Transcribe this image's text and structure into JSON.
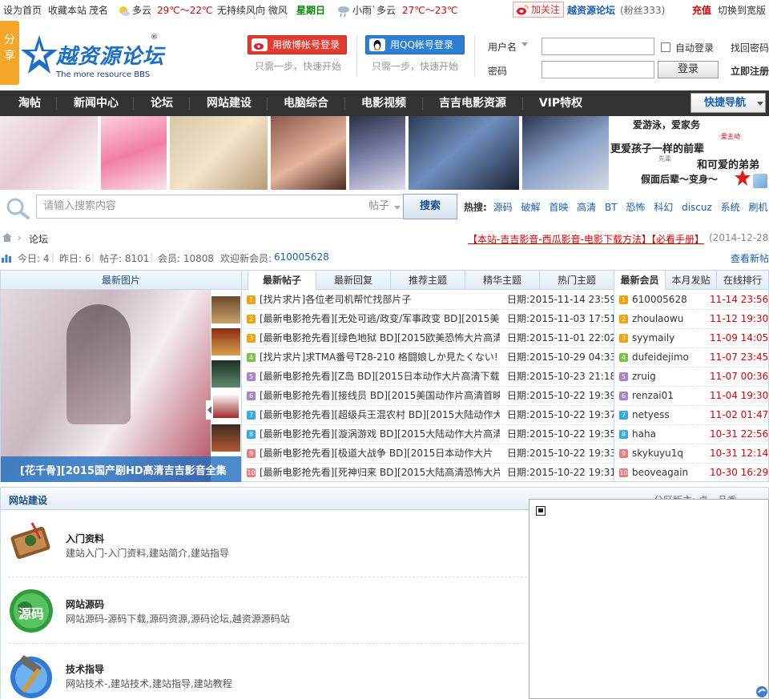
{
  "topbar": {
    "set_home": "设为首页",
    "bookmark": "收藏本站",
    "city": "茂名",
    "weather1": "多云",
    "temp1": "29℃～22℃",
    "wind": "无持续风向 微风",
    "weekday": "星期日",
    "weather2": "小雨`多云",
    "temp2": "27℃～23℃",
    "follow": "加关注",
    "weibo_name": "越资源论坛",
    "fans": "(粉丝333)",
    "recharge": "充值",
    "wide": "切换到宽版"
  },
  "header": {
    "share": "分享",
    "logo_title": "越资源论坛",
    "logo_sub": "The more resource BBS",
    "logo_reg": "®",
    "weibo_login": "用微博帐号登录",
    "qq_login": "用QQ帐号登录",
    "hint": "只需一步，快速开始",
    "username_label": "用户名",
    "password_label": "密码",
    "auto_login": "自动登录",
    "login": "登录",
    "find_password": "找回密码",
    "register": "立即注册"
  },
  "nav": {
    "items": [
      "淘帖",
      "新闻中心",
      "论坛",
      "网站建设",
      "电脑综合",
      "电影视频",
      "吉吉电影资源",
      "VIP特权"
    ],
    "quick_nav": "快捷导航"
  },
  "ad": {
    "line1": "爱游泳，爱家务",
    "line2": "更爱孩子一样的前辈",
    "line3": "和可爱的弟弟",
    "line4": "假面后辈～变身～",
    "tag1": "爱主动",
    "tag2": "先辈"
  },
  "search": {
    "placeholder": "请输入搜索内容",
    "type": "帖子",
    "button": "搜索",
    "hot_label": "热搜:",
    "hot_words": [
      "源码",
      "破解",
      "首映",
      "高清",
      "BT",
      "恐怖",
      "科幻",
      "discuz",
      "系统",
      "刷机"
    ]
  },
  "crumb": {
    "current": "论坛",
    "notice": "【本站-吉吉影音-西瓜影音-电影下载方法】【必看手册】",
    "notice_date": "(2014-12-28)"
  },
  "stats": {
    "today": "今日: 4",
    "yesterday": "昨日: 6",
    "posts": "帖子: 8101",
    "members": "会员: 10808",
    "welcome": "欢迎新会员: ",
    "new_member": "610005628",
    "view_new": "查看新帖"
  },
  "pics": {
    "tab": "最新图片",
    "caption": "[花千骨][2015国产剧HD高清吉吉影音全集"
  },
  "threads": {
    "tabs": [
      "最新帖子",
      "最新回复",
      "推荐主题",
      "精华主题",
      "热门主题"
    ],
    "items": [
      {
        "n": "1",
        "title": "[找片求片]各位老司机帮忙找部片子",
        "date": "日期:2015-11-14 23:59"
      },
      {
        "n": "2",
        "title": "[最新电影抢先看][无处可逃/政变/军事政变 BD][2015美国",
        "date": "日期:2015-11-03 17:51"
      },
      {
        "n": "3",
        "title": "[最新电影抢先看][绿色地狱 BD][2015欧美恐怖大片高清",
        "date": "日期:2015-11-01 22:02"
      },
      {
        "n": "4",
        "title": "[找片求片]求TMA番号T28-210 格闘娘しか見たくない! 4",
        "date": "日期:2015-10-29 04:33"
      },
      {
        "n": "5",
        "title": "[最新电影抢先看][Z岛 BD][2015日本动作大片高清下载]",
        "date": "日期:2015-10-23 21:18"
      },
      {
        "n": "6",
        "title": "[最新电影抢先看][接线员 BD][2015美国动作片高清首映",
        "date": "日期:2015-10-22 19:39"
      },
      {
        "n": "7",
        "title": "[最新电影抢先看][超级兵王混农村 BD][2015大陆动作大",
        "date": "日期:2015-10-22 19:37"
      },
      {
        "n": "8",
        "title": "[最新电影抢先看][漩涡游戏 BD][2015大陆动作大片高清",
        "date": "日期:2015-10-22 19:35"
      },
      {
        "n": "9",
        "title": "[最新电影抢先看][极道大战争 BD][2015日本动作大片",
        "date": "日期:2015-10-22 19:33"
      },
      {
        "n": "10",
        "title": "[最新电影抢先看][死神归来 BD][2015大陆高清恐怖大片",
        "date": "日期:2015-10-22 19:31"
      }
    ]
  },
  "members": {
    "tabs": [
      "最新会员",
      "本月发贴",
      "在线排行"
    ],
    "items": [
      {
        "n": "1",
        "name": "610005628",
        "date": "11-14 23:56"
      },
      {
        "n": "2",
        "name": "zhoulaowu",
        "date": "11-12 19:30"
      },
      {
        "n": "3",
        "name": "syymaily",
        "date": "11-09 14:05"
      },
      {
        "n": "4",
        "name": "dufeidejimo",
        "date": "11-07 23:45"
      },
      {
        "n": "5",
        "name": "zruig",
        "date": "11-07 00:36"
      },
      {
        "n": "6",
        "name": "renzai01",
        "date": "11-04 19:30"
      },
      {
        "n": "7",
        "name": "netyess",
        "date": "11-02 01:47"
      },
      {
        "n": "8",
        "name": "haha",
        "date": "10-31 22:56"
      },
      {
        "n": "9",
        "name": "skykuyu1q",
        "date": "10-31 12:14"
      },
      {
        "n": "10",
        "name": "beoveagain",
        "date": "10-30 16:29"
      }
    ]
  },
  "section": {
    "title": "网站建设",
    "moderator": "分区版主: 卓一品秀",
    "forums": [
      {
        "title": "入门资料",
        "desc": "建站入门-入门资料,建站简介,建站指导"
      },
      {
        "title": "网站源码",
        "desc": "网站源码-源码下载,源码资源,源码论坛,越资源源码站"
      },
      {
        "title": "技术指导",
        "desc": "网站技术-,建站技术,建站指导,建站教程"
      }
    ],
    "icon_text_2": "源码"
  },
  "colors": {
    "accent": "#1a5fb4",
    "nav_bg": "#333333",
    "red": "#dd0000",
    "orange": "#f4a62a"
  }
}
